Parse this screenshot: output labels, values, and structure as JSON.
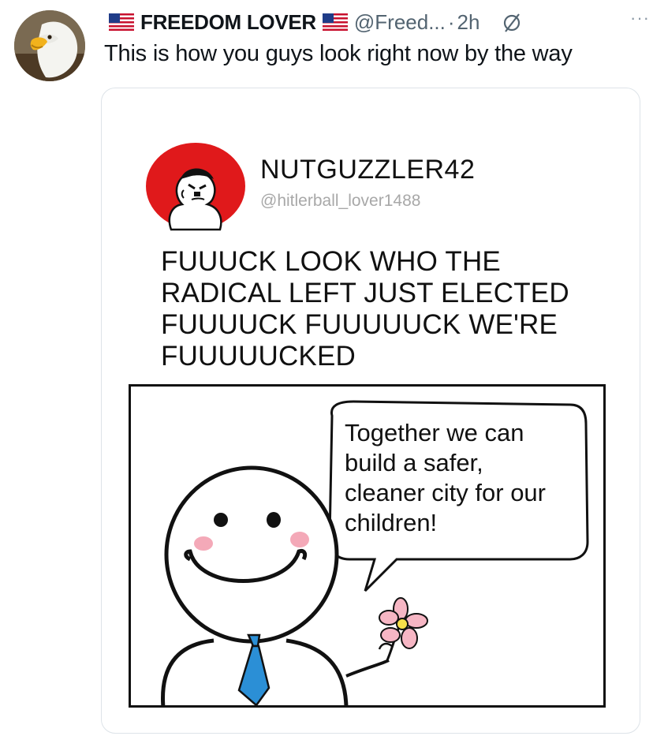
{
  "post": {
    "display_name": "FREEDOM LOVER",
    "handle": "@Freed...",
    "separator": "·",
    "time": "2h",
    "more_glyph": "···",
    "text": "This is how you guys look right now by the way",
    "flag_icon": "us-flag-icon",
    "avatar_icon": "bald-eagle-avatar"
  },
  "embedded": {
    "name": "NUTGUZZLER42",
    "handle": "@hitlerball_lover1488",
    "text_lines": [
      "FUUUCK LOOK WHO THE",
      "RADICAL LEFT JUST ELECTED",
      "FUUUUCK FUUUUUCK WE'RE",
      "FUUUUUCKED"
    ],
    "speech_lines": [
      "Together we can",
      "build a safer,",
      "cleaner city for our",
      "children!"
    ]
  },
  "colors": {
    "text": "#0f1419",
    "muted": "#536471",
    "card_border": "#dde3e8",
    "avatar_red": "#e0191b",
    "tie_blue": "#2b8fd6",
    "blush": "#f4a9b8"
  }
}
